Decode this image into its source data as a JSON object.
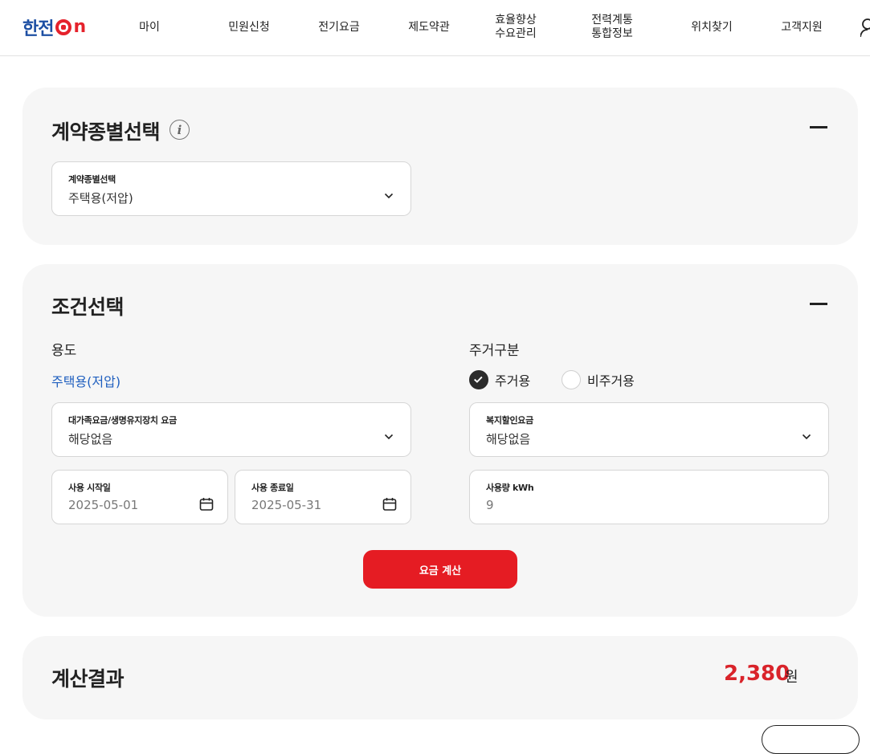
{
  "header": {
    "logo_text": "한전",
    "logo_suffix": "n",
    "nav": [
      {
        "line1": "마이",
        "line2": ""
      },
      {
        "line1": "민원신청",
        "line2": ""
      },
      {
        "line1": "전기요금",
        "line2": ""
      },
      {
        "line1": "제도약관",
        "line2": ""
      },
      {
        "line1": "효율향상",
        "line2": "수요관리"
      },
      {
        "line1": "전력계통",
        "line2": "통합정보"
      },
      {
        "line1": "위치찾기",
        "line2": ""
      },
      {
        "line1": "고객지원",
        "line2": ""
      }
    ],
    "user_icon": "user-icon"
  },
  "contract": {
    "title": "계약종별선택",
    "info_glyph": "i",
    "select_label": "계약종별선택",
    "select_value": "주택용(저압)"
  },
  "conditions": {
    "title": "조건선택",
    "usage_label": "용도",
    "usage_value": "주택용(저압)",
    "residence_label": "주거구분",
    "radio_options": [
      {
        "label": "주거용",
        "checked": true
      },
      {
        "label": "비주거용",
        "checked": false
      }
    ],
    "family_discount": {
      "label": "대가족요금/생명유지장치 요금",
      "value": "해당없음"
    },
    "welfare_discount": {
      "label": "복지할인요금",
      "value": "해당없음"
    },
    "start_date": {
      "label": "사용 시작일",
      "value": "2025-05-01"
    },
    "end_date": {
      "label": "사용 종료일",
      "value": "2025-05-31"
    },
    "usage_kwh": {
      "label": "사용량 kWh",
      "value": "9"
    },
    "calculate_button": "요금 계산"
  },
  "result": {
    "title": "계산결과",
    "amount": "2,380",
    "unit": "원"
  },
  "colors": {
    "brand_blue": "#1d4fa3",
    "brand_red": "#e5222c",
    "button_red": "#e51c23",
    "amount_red": "#d9232a",
    "link_blue": "#1f5fbf",
    "card_bg": "#f6f6f6"
  }
}
